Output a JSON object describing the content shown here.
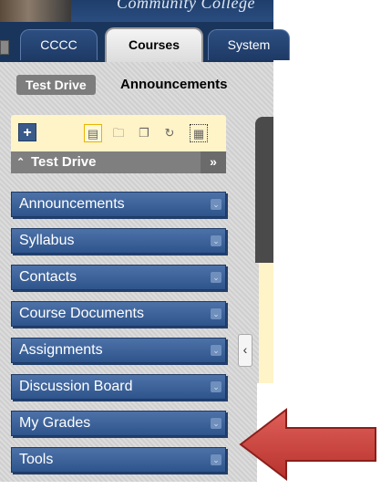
{
  "banner": {
    "college_text": "Community College"
  },
  "tabs": [
    {
      "label": "CCCC",
      "active": false
    },
    {
      "label": "Courses",
      "active": true
    },
    {
      "label": "System",
      "active": false
    }
  ],
  "breadcrumb": {
    "course": "Test Drive",
    "current": "Announcements"
  },
  "toolbar": {
    "add_icon": "plus-icon",
    "icons": [
      "list-view-icon",
      "folder-icon",
      "window-icon",
      "refresh-icon",
      "grid-view-icon"
    ]
  },
  "course_menu": {
    "title": "Test Drive",
    "collapse_label": "»",
    "items": [
      {
        "label": "Announcements"
      },
      {
        "label": "Syllabus"
      },
      {
        "label": "Contacts"
      },
      {
        "label": "Course Documents"
      },
      {
        "label": "Assignments"
      },
      {
        "label": "Discussion Board"
      },
      {
        "label": "My Grades"
      },
      {
        "label": "Tools"
      }
    ]
  },
  "colors": {
    "menu_blue": "#3b5f95",
    "toolbar_yellow": "#fff3c8",
    "arrow_red": "#c8423c",
    "nav_dark": "#1a355c"
  }
}
